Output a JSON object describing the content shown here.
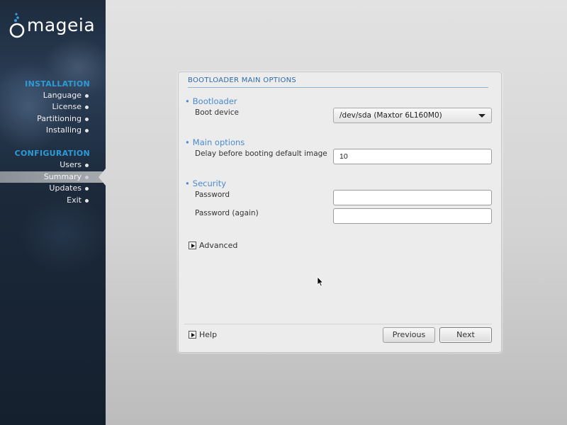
{
  "brand": {
    "name": "mageia"
  },
  "sidebar": {
    "sections": [
      {
        "title": "INSTALLATION",
        "items": [
          "Language",
          "License",
          "Partitioning",
          "Installing"
        ]
      },
      {
        "title": "CONFIGURATION",
        "items": [
          "Users",
          "Summary",
          "Updates",
          "Exit"
        ]
      }
    ],
    "active_item": "Summary"
  },
  "panel": {
    "title": "BOOTLOADER MAIN OPTIONS",
    "bootloader": {
      "heading": "Bootloader",
      "boot_device_label": "Boot device",
      "boot_device_value": "/dev/sda (Maxtor 6L160M0)"
    },
    "main_options": {
      "heading": "Main options",
      "delay_label": "Delay before booting default image",
      "delay_value": "10"
    },
    "security": {
      "heading": "Security",
      "password_label": "Password",
      "password_value": "",
      "password_again_label": "Password (again)",
      "password_again_value": ""
    },
    "advanced_label": "Advanced",
    "help_label": "Help",
    "previous_label": "Previous",
    "next_label": "Next"
  },
  "colors": {
    "accent": "#2e9ad8",
    "heading": "#4a8ad0",
    "sidebar_bg": "#1d2b3d",
    "active_item_bg": "#9a9ea2"
  }
}
